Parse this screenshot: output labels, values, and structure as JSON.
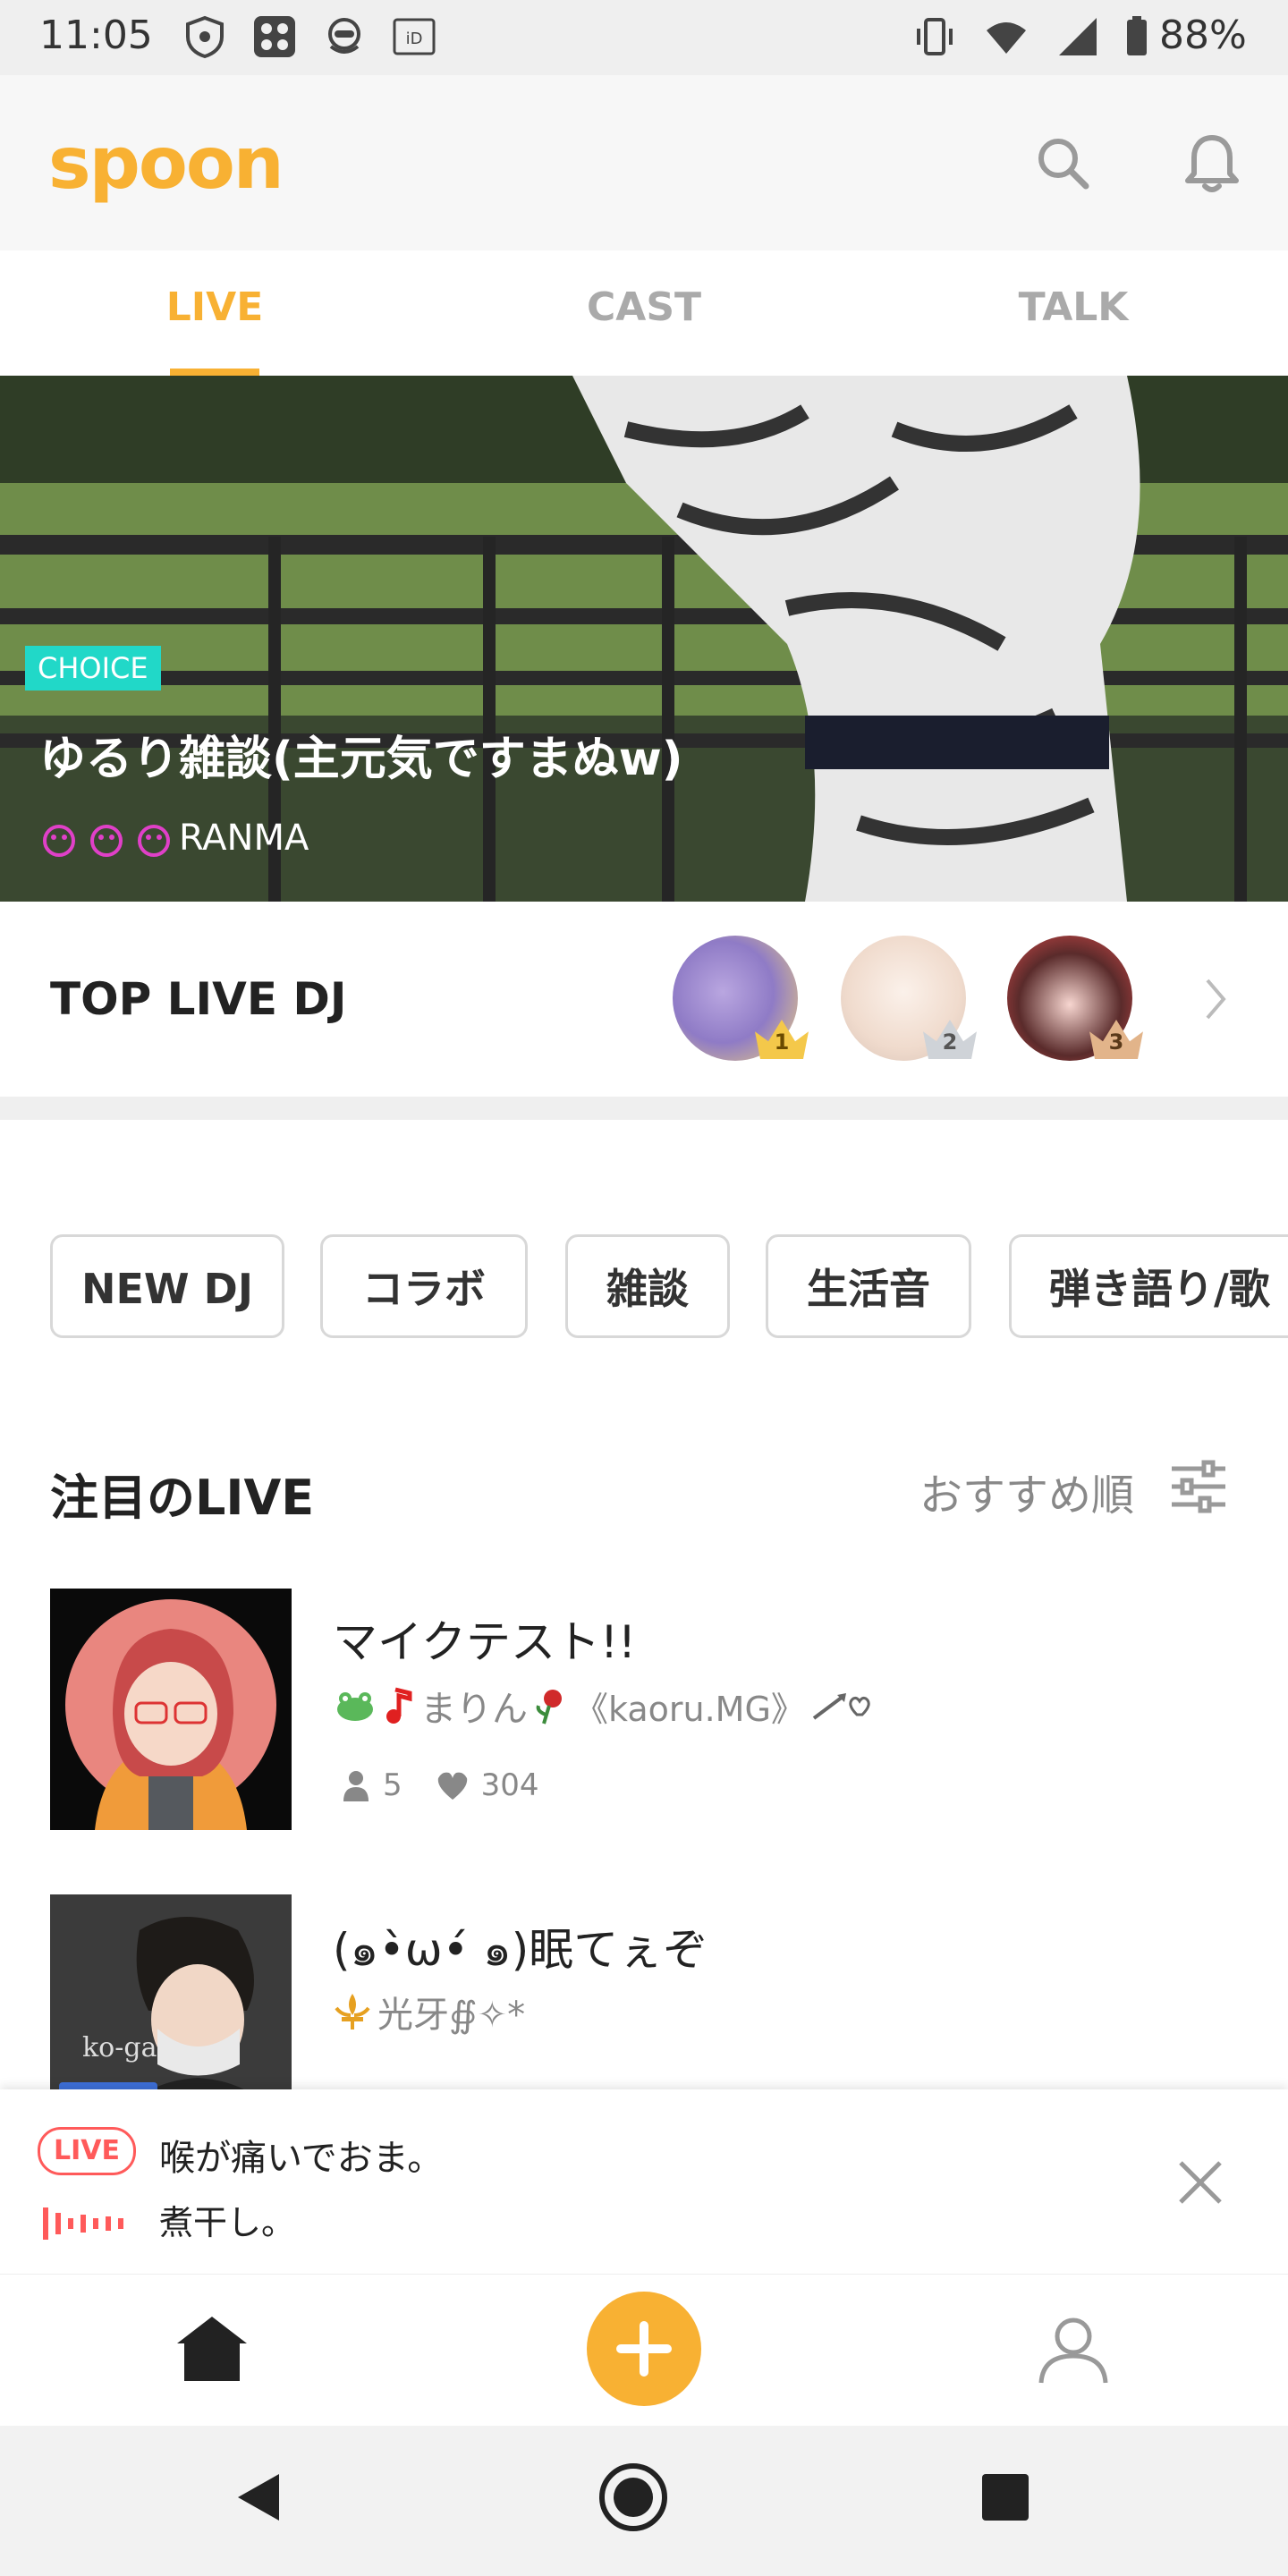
{
  "status_bar": {
    "time": "11:05",
    "battery": "88%"
  },
  "header": {
    "logo": "spoon"
  },
  "tabs": [
    {
      "label": "LIVE"
    },
    {
      "label": "CAST"
    },
    {
      "label": "TALK"
    }
  ],
  "banner": {
    "badge": "CHOICE",
    "title": "ゆるり雑談(主元気ですまぬw)",
    "dj_name": "RANMA"
  },
  "top_live_dj": {
    "title": "TOP LIVE DJ",
    "ranks": [
      "1",
      "2",
      "3"
    ]
  },
  "categories": [
    "NEW DJ",
    "コラボ",
    "雑談",
    "生活音",
    "弾き語り/歌"
  ],
  "featured": {
    "title": "注目のLIVE",
    "sort_label": "おすすめ順"
  },
  "live_items": [
    {
      "title": "マイクテスト!!",
      "dj": "まりん",
      "dj_suffix": "《kaoru.MG》",
      "listeners": "5",
      "likes": "304"
    },
    {
      "title": "(๑•̀ω•́ ๑)眠てぇぞ",
      "dj": "光牙∯✧*",
      "thumb_text": "ko-ga"
    }
  ],
  "mini_player": {
    "badge": "LIVE",
    "title": "喉が痛いでおま。",
    "dj": "煮干し。"
  },
  "colors": {
    "accent": "#f8b133",
    "choice": "#21d8c8",
    "live_red": "#ff5a5a"
  }
}
